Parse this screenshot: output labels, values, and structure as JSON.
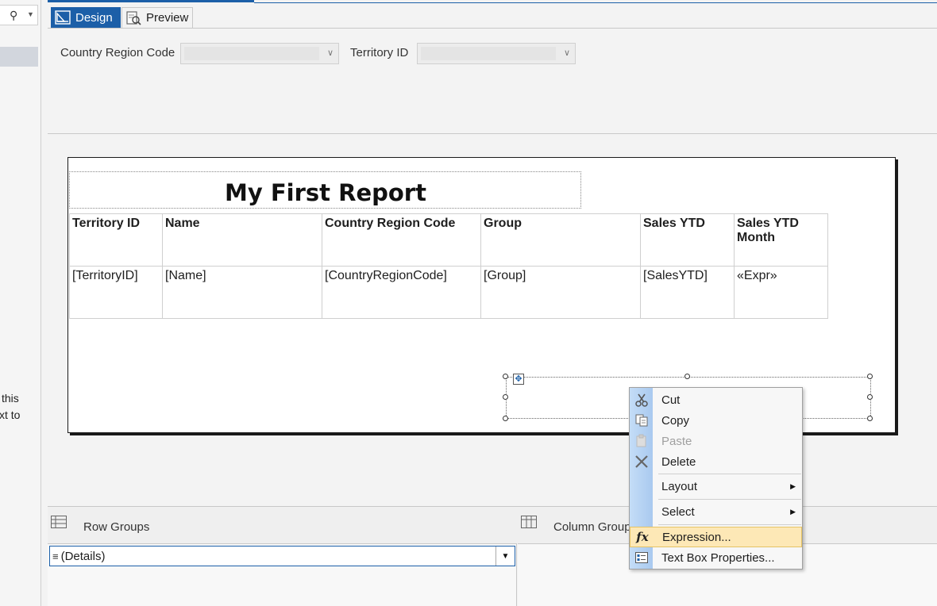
{
  "left_panel": {
    "search_icon": "search-icon",
    "text_line1": "this",
    "text_line2": "xt to"
  },
  "tabs": {
    "design": "Design",
    "preview": "Preview"
  },
  "parameters": {
    "country_region_code_label": "Country Region Code",
    "country_region_code_value": "",
    "territory_id_label": "Territory ID",
    "territory_id_value": ""
  },
  "report": {
    "title": "My First Report",
    "columns": [
      "Territory ID",
      "Name",
      "Country Region Code",
      "Group",
      "Sales YTD",
      "Sales YTD Month"
    ],
    "detail_row": [
      "[TerritoryID]",
      "[Name]",
      "[CountryRegionCode]",
      "[Group]",
      "[SalesYTD]",
      "«Expr»"
    ]
  },
  "groups": {
    "row_groups_title": "Row Groups",
    "column_groups_title": "Column Groups",
    "details_item": "(Details)"
  },
  "context_menu": {
    "cut": "Cut",
    "copy": "Copy",
    "paste": "Paste",
    "delete": "Delete",
    "layout": "Layout",
    "select": "Select",
    "expression": "Expression...",
    "text_box_properties": "Text Box Properties..."
  },
  "colors": {
    "accent": "#1c5fa8",
    "highlight": "#fde8b6"
  }
}
